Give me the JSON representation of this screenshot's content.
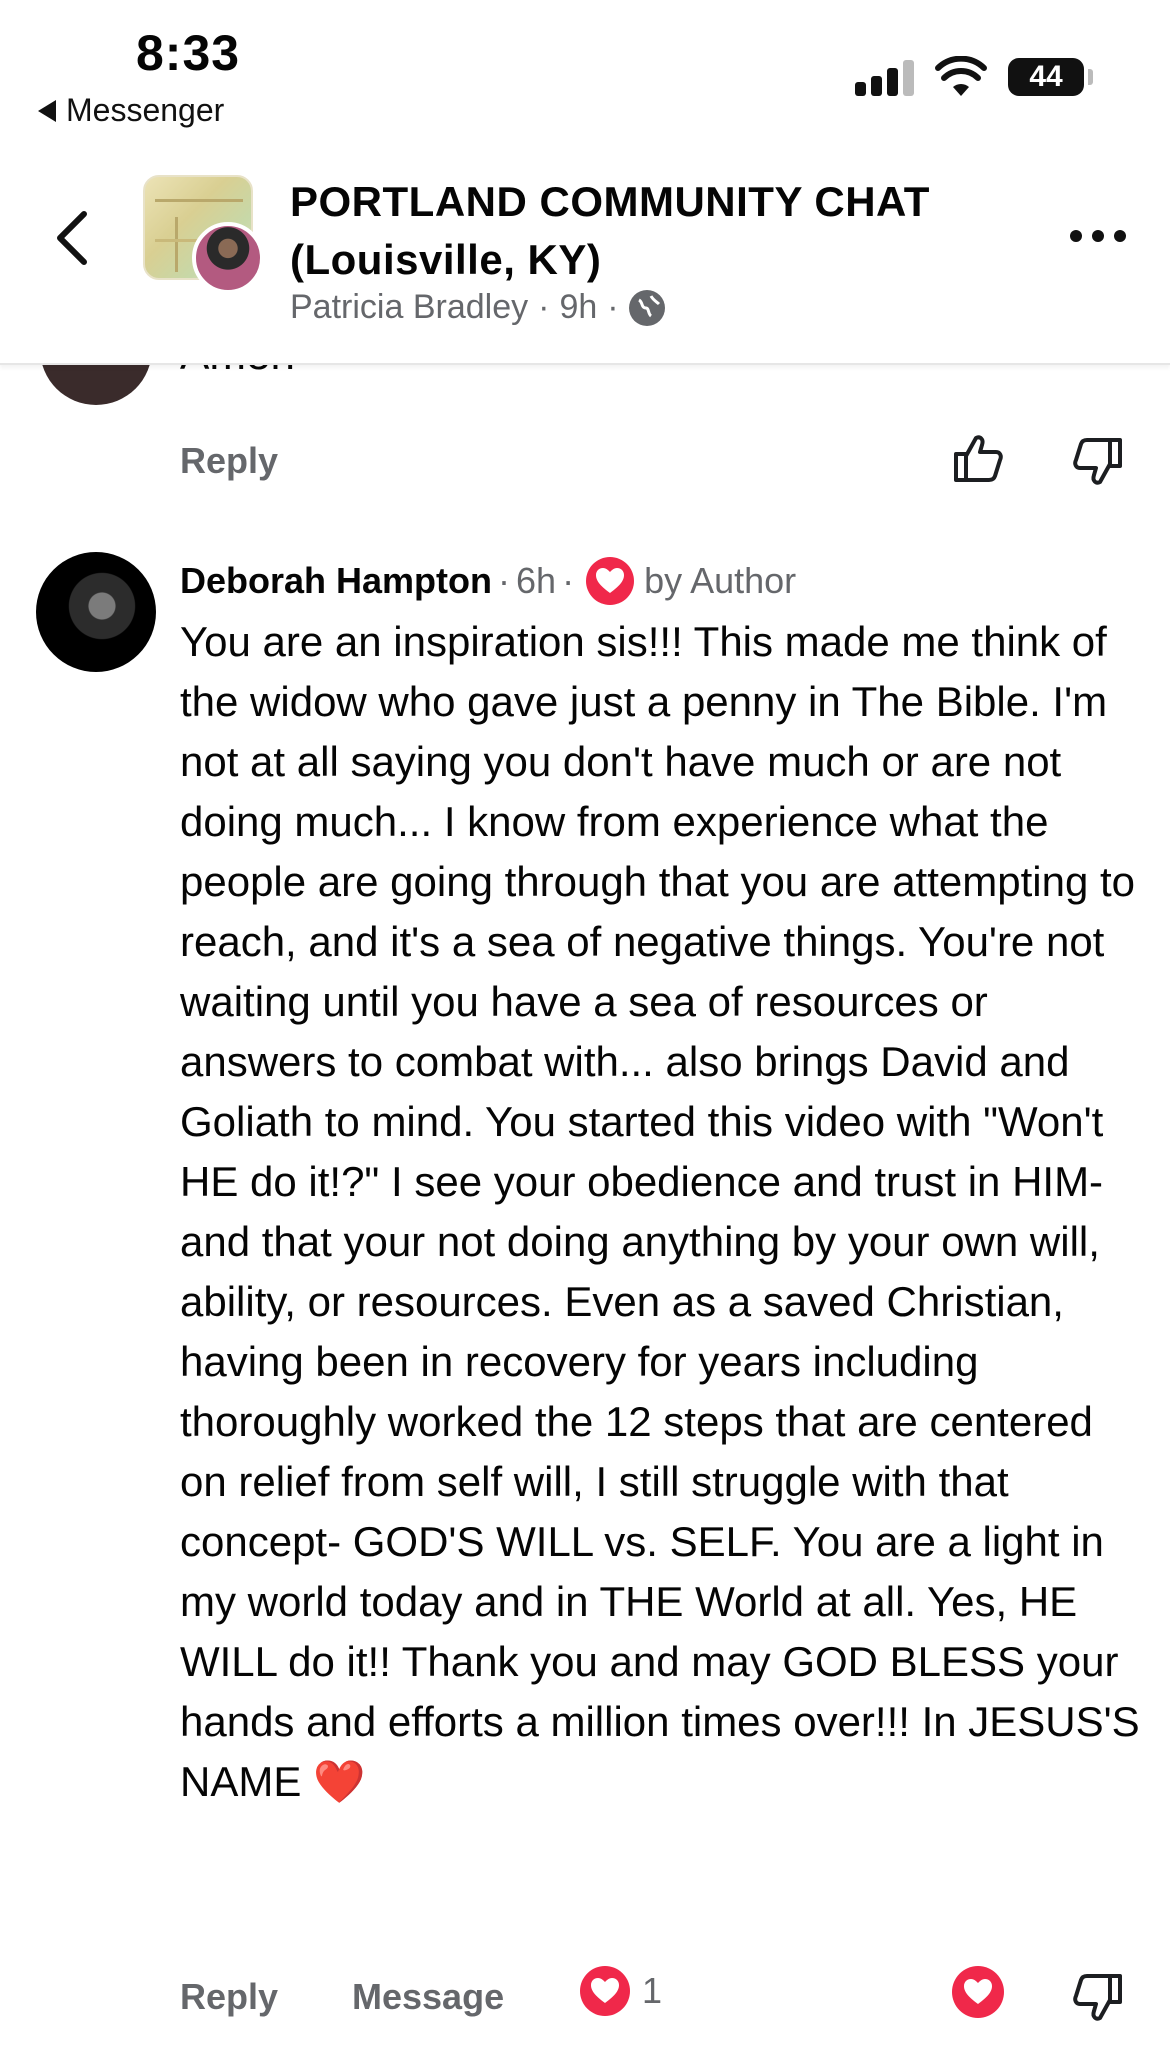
{
  "status_bar": {
    "time": "8:33",
    "back_app": "Messenger",
    "battery": "44"
  },
  "header": {
    "title": "PORTLAND COMMUNITY CHAT (Louisville, KY)",
    "poster": "Patricia Bradley",
    "separator": "·",
    "time_ago": "9h",
    "privacy_icon": "globe-icon"
  },
  "previous_comment": {
    "text_partial": "Amen",
    "reply_label": "Reply"
  },
  "comment": {
    "author": "Deborah Hampton",
    "time_ago": "6h",
    "separator": "·",
    "reaction_badge_label": "by Author",
    "body": "You are an inspiration sis!!! This made me think of the widow who gave just a penny in The Bible. I'm not at all saying you don't have much or are not doing much... I know from experience what the people are going through that you are attempting to reach, and it's a sea of negative things. You're not waiting until you have a sea of resources or answers to combat with... also brings David and Goliath to mind. You started this video with \"Won't HE do it!?\" I see your obedience and trust in HIM- and that your not doing anything by your own will, ability, or resources. Even as a saved Christian, having been in recovery for years including thoroughly worked the 12 steps that are centered on relief from self will, I still struggle with that concept- GOD'S WILL vs. SELF. You are a light in my world today and in THE World at all. Yes, HE WILL do it!! Thank you and may GOD BLESS your hands and efforts a million times over!!! In JESUS'S NAME ❤️",
    "reply_label": "Reply",
    "message_label": "Message",
    "reaction_count": "1"
  },
  "colors": {
    "heart": "#f0284a",
    "secondary_text": "#65676b",
    "primary_text": "#050505"
  }
}
